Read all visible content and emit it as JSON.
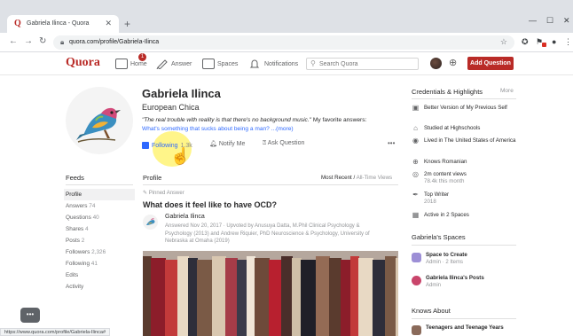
{
  "browser": {
    "tab_title": "Gabriela Ilinca - Quora",
    "tab_favicon": "Q",
    "url": "quora.com/profile/Gabriela-Ilinca",
    "status_url": "https://www.quora.com/profile/Gabriela-Ilinca#"
  },
  "header": {
    "logo": "Quora",
    "nav": [
      {
        "label": "Home",
        "icon": "home-icon"
      },
      {
        "label": "Answer",
        "icon": "pencil-icon"
      },
      {
        "label": "Spaces",
        "icon": "spaces-icon"
      },
      {
        "label": "Notifications",
        "icon": "bell-icon"
      }
    ],
    "home_badge": "1",
    "search_placeholder": "Search Quora",
    "add_question": "Add Question"
  },
  "profile": {
    "name": "Gabriela Ilinca",
    "tagline": "European Chica",
    "bio_quote": "\"The real trouble with reality is that there's no background music.\"",
    "bio_rest": " My favorite answers:",
    "bio_link": "What's something that sucks about being a man?",
    "bio_more": " ...(more)",
    "following_label": "Following",
    "following_count": "1.3k",
    "notify_label": "Notify Me",
    "ask_label": "Ask Question",
    "more_label": "•••"
  },
  "feeds": {
    "title": "Feeds",
    "items": [
      {
        "label": "Profile",
        "count": ""
      },
      {
        "label": "Answers",
        "count": "74"
      },
      {
        "label": "Questions",
        "count": "40"
      },
      {
        "label": "Shares",
        "count": "4"
      },
      {
        "label": "Posts",
        "count": "2"
      },
      {
        "label": "Followers",
        "count": "2,326"
      },
      {
        "label": "Following",
        "count": "41"
      },
      {
        "label": "Edits",
        "count": ""
      },
      {
        "label": "Activity",
        "count": ""
      }
    ]
  },
  "content": {
    "title": "Profile",
    "sort_selected": "Most Recent",
    "sort_alt": "All-Time Views",
    "pinned_label": "Pinned Answer",
    "question": "What does it feel like to have OCD?",
    "author": "Gabriela Ilinca",
    "credential": "Answered Nov 20, 2017 · Upvoted by Anusuya Datta, M.Phil Clinical Psychology & Psychology (2013) and Andrew Riquier, PhD Neuroscience & Psychology, University of Nebraska at Omaha (2019)"
  },
  "credentials": {
    "title": "Credentials & Highlights",
    "more": "More",
    "items": [
      {
        "icon": "briefcase-icon",
        "text": "Better Version of My Previous Self",
        "sub": ""
      },
      {
        "icon": "graduation-cap-icon",
        "text": "Studied at Highschools",
        "sub": ""
      },
      {
        "icon": "location-pin-icon",
        "text": "Lived in The United States of America",
        "sub": ""
      },
      {
        "icon": "globe-icon",
        "text": "Knows Romanian",
        "sub": ""
      },
      {
        "icon": "eye-icon",
        "text": "2m content views",
        "sub": "78.4k this month"
      },
      {
        "icon": "quill-icon",
        "text": "Top Writer",
        "sub": "2018"
      },
      {
        "icon": "spaces-icon",
        "text": "Active in 2 Spaces",
        "sub": ""
      }
    ]
  },
  "spaces": {
    "title": "Gabriela's Spaces",
    "items": [
      {
        "name": "Space to Create",
        "sub": "Admin · 2 Items",
        "color": "#9d8fd6"
      },
      {
        "name": "Gabriela Ilinca's Posts",
        "sub": "Admin",
        "color": "#c9456b"
      }
    ]
  },
  "knows_about": {
    "title": "Knows About",
    "items": [
      {
        "name": "Teenagers and Teenage Years"
      }
    ]
  },
  "colors": {
    "brand": "#b92b27",
    "link": "#2e69ff"
  }
}
